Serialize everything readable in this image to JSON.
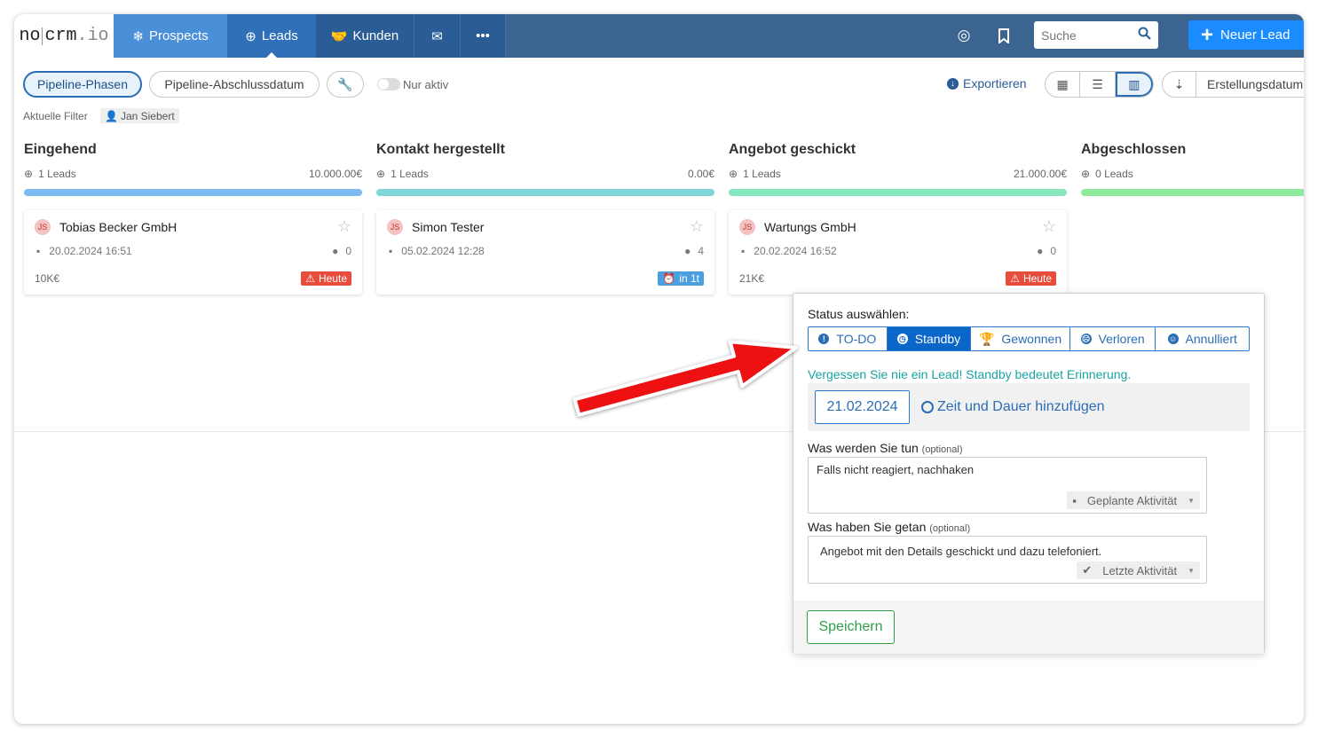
{
  "logo": {
    "part1": "no",
    "part2": "crm",
    "part3": ".io"
  },
  "nav": {
    "prospects": "Prospects",
    "leads": "Leads",
    "kunden": "Kunden"
  },
  "search": {
    "placeholder": "Suche"
  },
  "new_lead": "Neuer Lead",
  "toolbar": {
    "pipeline_phasen": "Pipeline-Phasen",
    "pipeline_abschluss": "Pipeline-Abschlussdatum",
    "nur_aktiv": "Nur aktiv",
    "exportieren": "Exportieren",
    "sort_label": "Erstellungsdatum"
  },
  "filter": {
    "label": "Aktuelle Filter",
    "chip": "Jan Siebert"
  },
  "columns": [
    {
      "title": "Eingehend",
      "leads": "1 Leads",
      "total": "10.000.00€",
      "bar_color": "#7dbbf0"
    },
    {
      "title": "Kontakt hergestellt",
      "leads": "1 Leads",
      "total": "0.00€",
      "bar_color": "#7fd6d6"
    },
    {
      "title": "Angebot geschickt",
      "leads": "1 Leads",
      "total": "21.000.00€",
      "bar_color": "#86e6c0"
    },
    {
      "title": "Abgeschlossen",
      "leads": "0 Leads",
      "total": "",
      "bar_color": "#8eea9a"
    }
  ],
  "cards": [
    {
      "initials": "JS",
      "name": "Tobias Becker GmbH",
      "date": "20.02.2024 16:51",
      "comments": "0",
      "amount": "10K€",
      "badge": "Heute"
    },
    {
      "initials": "JS",
      "name": "Simon Tester",
      "date": "05.02.2024 12:28",
      "comments": "4",
      "amount": "",
      "badge": "in 1t"
    },
    {
      "initials": "JS",
      "name": "Wartungs GmbH",
      "date": "20.02.2024 16:52",
      "comments": "0",
      "amount": "21K€",
      "badge": "Heute"
    }
  ],
  "popup": {
    "status_label": "Status auswählen:",
    "statuses": [
      "TO-DO",
      "Standby",
      "Gewonnen",
      "Verloren",
      "Annulliert"
    ],
    "selected": "Standby",
    "hint": "Vergessen Sie nie ein Lead! Standby bedeutet Erinnerung.",
    "date": "21.02.2024",
    "add_time": "Zeit und Dauer hinzufügen",
    "todo_label": "Was werden Sie tun",
    "optional": "(optional)",
    "todo_text": "Falls nicht reagiert, nachhaken",
    "todo_select": "Geplante Aktivität",
    "done_label": "Was haben Sie getan",
    "done_text": "Angebot mit den Details geschickt und dazu telefoniert.",
    "done_select": "Letzte Aktivität",
    "save": "Speichern"
  },
  "colors": {
    "nav": "#3c6490",
    "accent": "#1a8cff",
    "danger": "#e74c3c",
    "success": "#2e9e4a",
    "arrow": "#ee1111"
  }
}
